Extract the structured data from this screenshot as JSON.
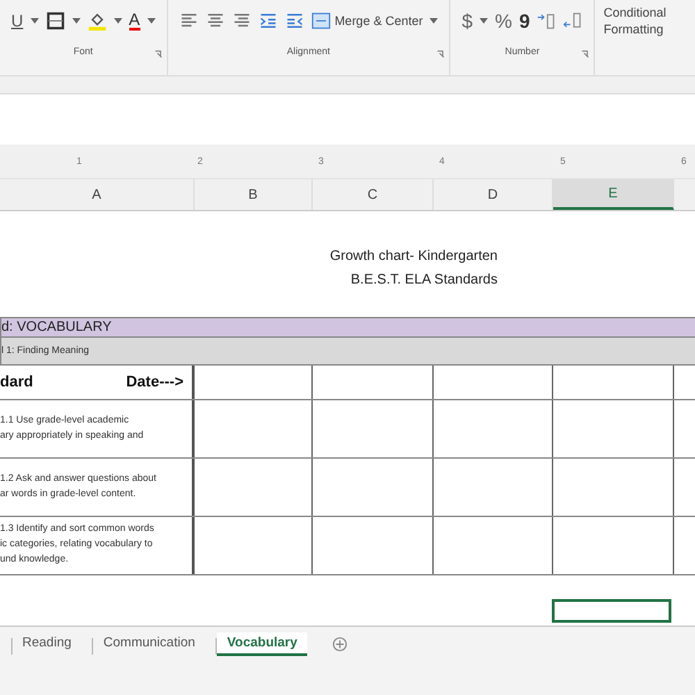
{
  "ribbon": {
    "font_group": {
      "label": "Font",
      "underline": "U",
      "font_color_letter": "A"
    },
    "alignment_group": {
      "label": "Alignment",
      "merge_button": "Merge & Center"
    },
    "number_group": {
      "label": "Number",
      "currency": "$",
      "percent": "%",
      "comma": "9"
    },
    "conditional_formatting": "Conditional Formatting"
  },
  "ruler": [
    "1",
    "2",
    "3",
    "4",
    "5",
    "6"
  ],
  "columns": [
    {
      "label": "A",
      "selected": false
    },
    {
      "label": "B",
      "selected": false
    },
    {
      "label": "C",
      "selected": false
    },
    {
      "label": "D",
      "selected": false
    },
    {
      "label": "E",
      "selected": true
    }
  ],
  "sheet": {
    "title_lines": [
      "Growth chart- Kindergarten",
      "B.E.S.T. ELA Standards"
    ],
    "strand": "d: VOCABULARY",
    "benchmark": "l 1: Finding Meaning",
    "header": {
      "standard": "dard",
      "date": "Date--->"
    },
    "rows": [
      {
        "text": "1.1 Use grade-level academic\nary appropriately in speaking and"
      },
      {
        "text": "1.2 Ask and answer questions about\nar words in grade-level content."
      },
      {
        "text": "1.3 Identify and sort common words\nic categories, relating vocabulary to\nund knowledge."
      }
    ]
  },
  "sheet_tabs": [
    {
      "label": "Reading",
      "selected": false
    },
    {
      "label": "Communication",
      "selected": false
    },
    {
      "label": "Vocabulary",
      "selected": true
    }
  ]
}
